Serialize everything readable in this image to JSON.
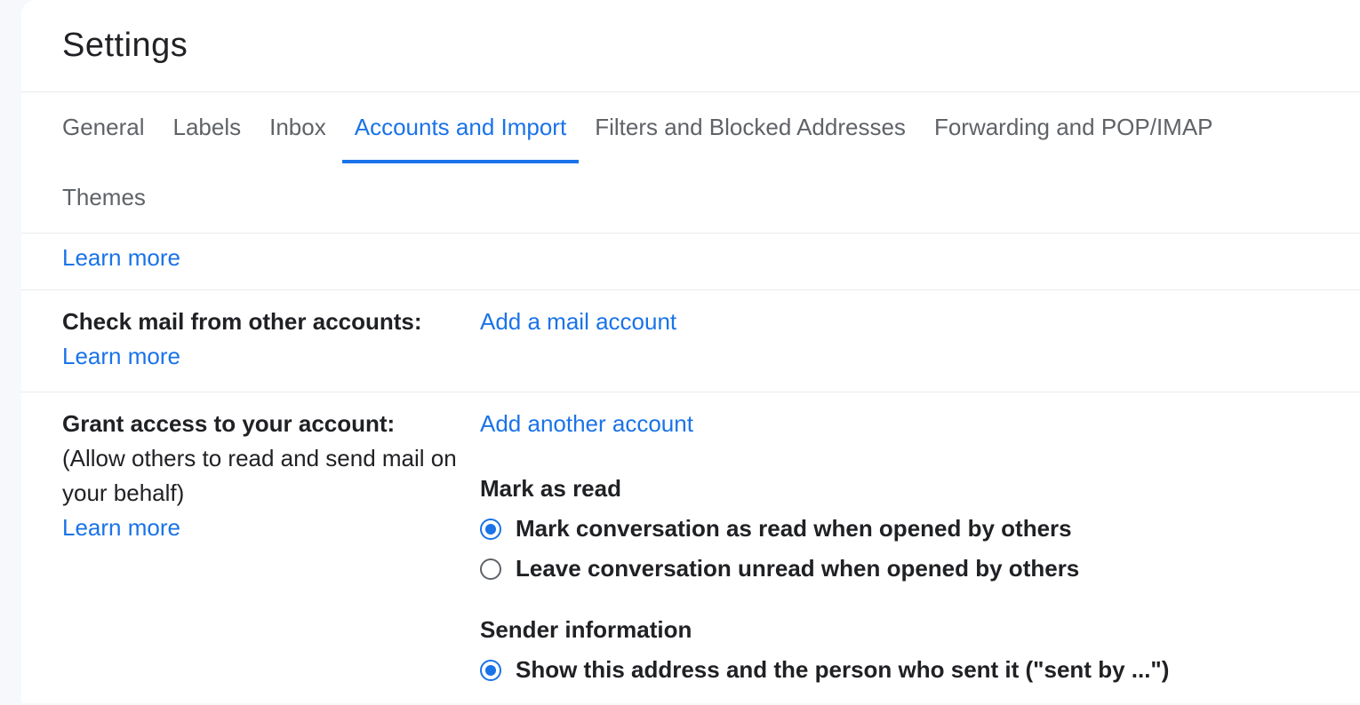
{
  "header": {
    "title": "Settings"
  },
  "tabs": [
    {
      "label": "General",
      "active": false
    },
    {
      "label": "Labels",
      "active": false
    },
    {
      "label": "Inbox",
      "active": false
    },
    {
      "label": "Accounts and Import",
      "active": true
    },
    {
      "label": "Filters and Blocked Addresses",
      "active": false
    },
    {
      "label": "Forwarding and POP/IMAP",
      "active": false
    },
    {
      "label": "Themes",
      "active": false
    }
  ],
  "top_section": {
    "learn_more": "Learn more"
  },
  "check_mail": {
    "label": "Check mail from other accounts:",
    "learn_more": "Learn more",
    "action": "Add a mail account"
  },
  "grant_access": {
    "label": "Grant access to your account:",
    "subtitle": "(Allow others to read and send mail on your behalf)",
    "learn_more": "Learn more",
    "action": "Add another account",
    "mark_as_read": {
      "heading": "Mark as read",
      "option1": "Mark conversation as read when opened by others",
      "option2": "Leave conversation unread when opened by others",
      "selected": 0
    },
    "sender_info": {
      "heading": "Sender information",
      "option1": "Show this address and the person who sent it (\"sent by ...\")",
      "selected": 0
    }
  }
}
